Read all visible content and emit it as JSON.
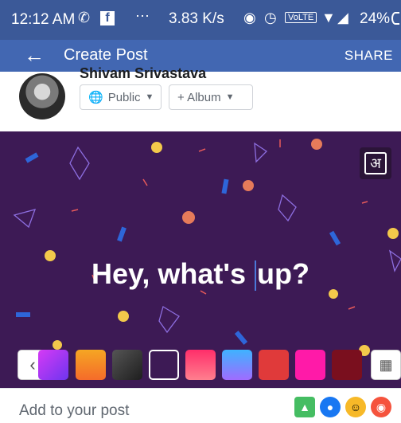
{
  "status_bar": {
    "time": "12:12 AM",
    "speed": "3.83 K/s",
    "volte": "VoLTE",
    "battery": "24%",
    "icons": [
      "whatsapp-icon",
      "facebook-icon",
      "more-dots-icon",
      "headphones-icon",
      "alarm-icon",
      "wifi-icon",
      "signal-icon",
      "battery-icon"
    ]
  },
  "app_bar": {
    "title": "Create Post",
    "share": "SHARE"
  },
  "user": {
    "name": "Shivam Srivastava",
    "privacy": "Public",
    "album": "+ Album"
  },
  "post": {
    "text_before": "Hey, what's ",
    "text_after": "up?",
    "script_toggle": "अ",
    "background_color": "#3d1a55",
    "swatches": [
      "#9b42f0",
      "#f49b2a",
      "#3a3a3a",
      "#3d1a55",
      "#ff3b6b",
      "#4aa8ff",
      "#e03a3a",
      "#ff1aa8",
      "#7a0f1e"
    ]
  },
  "composer": {
    "add_to_post": "Add to your post",
    "icons": [
      "photo-icon",
      "tag-people-icon",
      "feeling-icon",
      "location-icon"
    ]
  }
}
